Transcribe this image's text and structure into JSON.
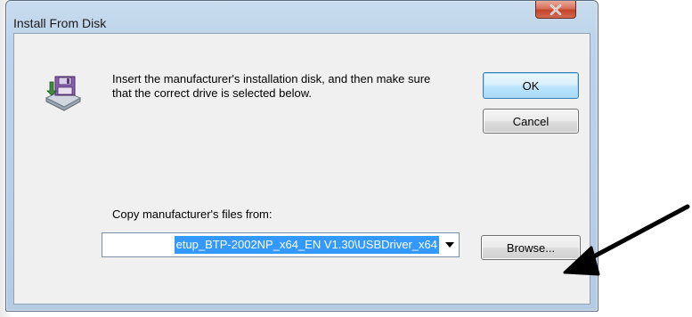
{
  "window": {
    "title": "Install From Disk",
    "close_icon": "close-x-icon"
  },
  "dialog": {
    "message": "Insert the manufacturer's installation disk, and then make sure that the correct drive is selected below.",
    "icon": "floppy-disk-install-icon",
    "copy_label": "Copy manufacturer's files from:",
    "path_value": "etup_BTP-2002NP_x64_EN V1.30\\USBDriver_x64",
    "path_dropdown_icon": "chevron-down-icon"
  },
  "buttons": {
    "ok": "OK",
    "cancel": "Cancel",
    "browse": "Browse..."
  },
  "annotation": {
    "icon": "arrow-pointer-icon",
    "color": "#000000"
  },
  "colors": {
    "selection": "#3399ff",
    "close_button": "#c4432b",
    "frame": "#b4cbe2"
  }
}
